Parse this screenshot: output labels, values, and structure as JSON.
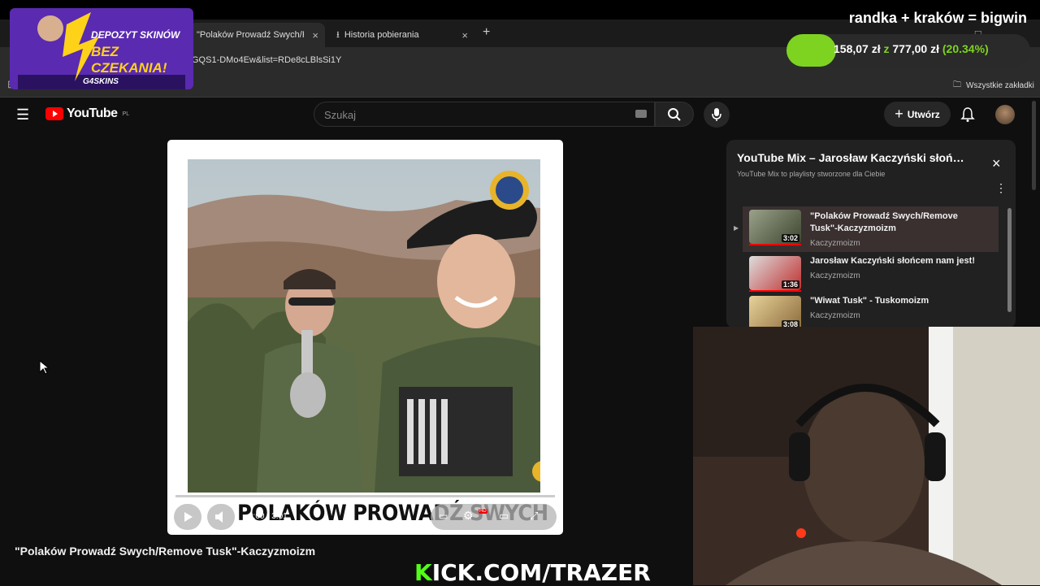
{
  "browser": {
    "tabs": [
      {
        "label": "\"Polaków Prowadź Swych/Remo",
        "active": true
      },
      {
        "label": "Historia pobierania",
        "active": false
      }
    ],
    "new_tab": "+",
    "close_glyph": "×",
    "address_fragment": "GQS1-DMo4Ew&list=RDe8cLBlsSi1Y",
    "bookmarks_all": "Wszystkie zakładki"
  },
  "youtube": {
    "logo_text": "YouTube",
    "region": "PL",
    "search_placeholder": "Szukaj",
    "create_label": "Utwórz",
    "video_caption_text": "POLAKÓW PROWADŹ SWYCH",
    "time_current": "0:00",
    "time_total": "3:01",
    "hd_badge": "HD",
    "video_title": "\"Polaków Prowadź Swych/Remove Tusk\"-Kaczyzmoizm"
  },
  "playlist": {
    "title": "YouTube Mix – Jarosław Kaczyński słoń…",
    "subtitle": "YouTube Mix to playlisty stworzone dla Ciebie",
    "items": [
      {
        "title": "\"Polaków Prowadź Swych/Remove Tusk\"-Kaczyzmoizm",
        "channel": "Kaczyzmoizm",
        "duration": "3:02",
        "playing": true
      },
      {
        "title": "Jarosław Kaczyński słońcem nam jest!",
        "channel": "Kaczyzmoizm",
        "duration": "1:36",
        "playing": false
      },
      {
        "title": "\"Wiwat Tusk\" - Tuskomoizm",
        "channel": "Kaczyzmoizm",
        "duration": "3:08",
        "playing": false
      }
    ]
  },
  "overlay": {
    "promo_line1": "DEPOZYT SKINÓW",
    "promo_line2": "BEZ CZEKANIA!",
    "promo_brand": "G4SKINS",
    "bet_text": "randka + kraków = bigwin",
    "bet_current": "158,07 zł",
    "bet_of": "z",
    "bet_target": "777,00 zł",
    "bet_percent": "(20.34%)",
    "bet_progress": 0.2034,
    "kick_k": "K",
    "kick_rest": "ICK.COM/TRAZER"
  },
  "colors": {
    "accent_red": "#ff0000",
    "kick_green": "#53fc18",
    "progress_green": "#7ed321"
  }
}
